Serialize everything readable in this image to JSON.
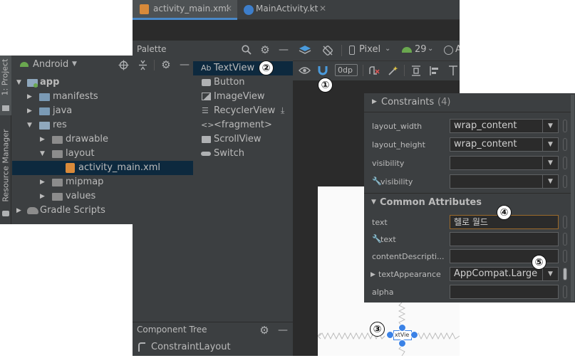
{
  "editor_tabs": [
    {
      "label": "activity_main.xml"
    },
    {
      "label": "MainActivity.kt"
    }
  ],
  "palette": {
    "title": "Palette",
    "items": [
      {
        "prefix": "Ab",
        "label": "TextView"
      },
      {
        "label": "Button"
      },
      {
        "label": "ImageView"
      },
      {
        "label": "RecyclerView"
      },
      {
        "prefix": "<>",
        "label": "<fragment>"
      },
      {
        "label": "ScrollView"
      },
      {
        "label": "Switch"
      }
    ]
  },
  "design_toolbar": {
    "device": "Pixel",
    "api": "29",
    "theme_partial": "A",
    "margin": "0dp"
  },
  "project": {
    "view": "Android",
    "tree": [
      {
        "label": "app"
      },
      {
        "label": "manifests"
      },
      {
        "label": "java"
      },
      {
        "label": "res"
      },
      {
        "label": "drawable"
      },
      {
        "label": "layout"
      },
      {
        "label": "activity_main.xml"
      },
      {
        "label": "mipmap"
      },
      {
        "label": "values"
      },
      {
        "label": "Gradle Scripts"
      }
    ],
    "side_tabs": [
      "1: Project",
      "Resource Manager"
    ]
  },
  "attributes": {
    "constraints_header": "Constraints",
    "constraints_count": "(4)",
    "layout_width_label": "layout_width",
    "layout_width_value": "wrap_content",
    "layout_height_label": "layout_height",
    "layout_height_value": "wrap_content",
    "visibility_label": "visibility",
    "tools_visibility_label": "visibility",
    "common_header": "Common Attributes",
    "text_label": "text",
    "text_value": "헬로 월드",
    "tools_text_label": "text",
    "content_desc_label": "contentDescripti...",
    "text_appearance_label": "textAppearance",
    "text_appearance_value": "AppCompat.Large",
    "alpha_label": "alpha"
  },
  "component_tree": {
    "title": "Component Tree",
    "root": "ConstraintLayout"
  },
  "canvas": {
    "widget_text": "xtVie"
  },
  "callouts": [
    "①",
    "②",
    "③",
    "④",
    "⑤"
  ]
}
